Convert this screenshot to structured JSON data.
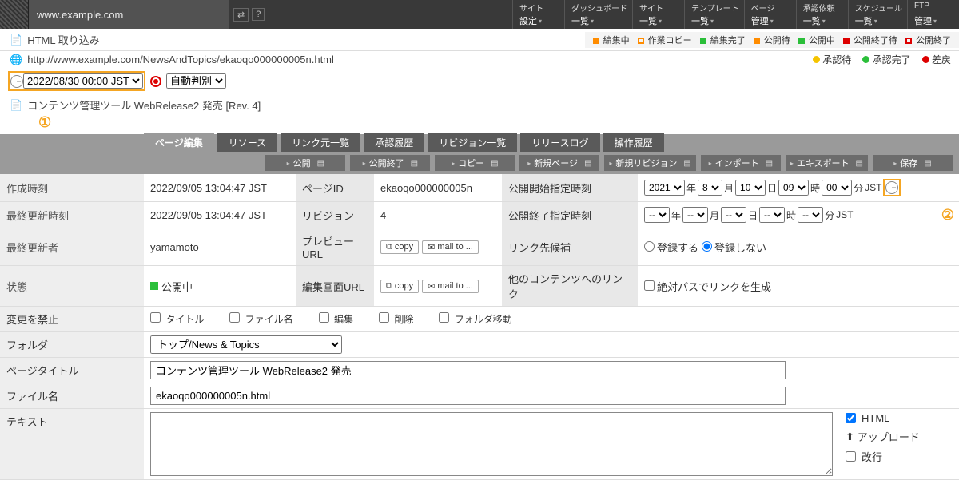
{
  "topbar": {
    "url_display": "www.example.com",
    "nav": [
      {
        "t1": "サイト",
        "t2": "設定"
      },
      {
        "t1": "ダッシュボード",
        "t2": "一覧"
      },
      {
        "t1": "サイト",
        "t2": "一覧"
      },
      {
        "t1": "テンプレート",
        "t2": "一覧"
      },
      {
        "t1": "ページ",
        "t2": "管理"
      },
      {
        "t1": "承認依頼",
        "t2": "一覧"
      },
      {
        "t1": "スケジュール",
        "t2": "一覧"
      },
      {
        "t1": "FTP",
        "t2": "管理"
      }
    ]
  },
  "status_strip": {
    "left_label": "HTML 取り込み",
    "items": [
      {
        "color": "#ff8c00",
        "shape": "sq",
        "label": "編集中"
      },
      {
        "color": "#ff8c00",
        "shape": "open",
        "label": "作業コピー"
      },
      {
        "color": "#2bbf3a",
        "shape": "sq",
        "label": "編集完了"
      },
      {
        "color": "#ff8c00",
        "shape": "sq",
        "label": "公開待"
      },
      {
        "color": "#2bbf3a",
        "shape": "sq",
        "label": "公開中"
      },
      {
        "color": "#d00",
        "shape": "sq",
        "label": "公開終了待"
      },
      {
        "color": "#d00",
        "shape": "open",
        "label": "公開終了"
      }
    ]
  },
  "path": "http://www.example.com/NewsAndTopics/ekaoqo000000005n.html",
  "approve_strip": [
    {
      "color": "#f5c400",
      "label": "承認待"
    },
    {
      "color": "#2bbf3a",
      "label": "承認完了"
    },
    {
      "color": "#d00",
      "label": "差戻"
    }
  ],
  "date_row": {
    "date_value": "2022/08/30 00:00 JST",
    "auto_value": "自動判別"
  },
  "desc_line": "コンテンツ管理ツール WebRelease2 発売 [Rev. 4]",
  "circle1": "①",
  "circle2": "②",
  "tabs": [
    "ページ編集",
    "リソース",
    "リンク元一覧",
    "承認履歴",
    "リビジョン一覧",
    "リリースログ",
    "操作履歴"
  ],
  "active_tab": 0,
  "actions": [
    "公開",
    "公開終了",
    "コピー",
    "新規ページ",
    "新規リビジョン",
    "インポート",
    "エキスポート",
    "保存"
  ],
  "grid": {
    "r1": {
      "l1": "作成時刻",
      "v1": "2022/09/05 13:04:47 JST",
      "l2": "ページID",
      "v2": "ekaoqo000000005n",
      "l3": "公開開始指定時刻"
    },
    "r1dates": {
      "year": "2021",
      "month": "8",
      "day": "10",
      "hour": "09",
      "min": "00",
      "tz": "JST"
    },
    "r2": {
      "l1": "最終更新時刻",
      "v1": "2022/09/05 13:04:47 JST",
      "l2": "リビジョン",
      "v2": "4",
      "l3": "公開終了指定時刻"
    },
    "r2dates": {
      "year": "--",
      "month": "--",
      "day": "--",
      "hour": "--",
      "min": "--",
      "tz": "JST"
    },
    "date_units": {
      "year": "年",
      "month": "月",
      "day": "日",
      "hour": "時",
      "min": "分"
    },
    "r3": {
      "l1": "最終更新者",
      "v1": "yamamoto",
      "l2": "プレビューURL",
      "copy": "copy",
      "mail": "mail to ...",
      "l3": "リンク先候補",
      "opt1": "登録する",
      "opt2": "登録しない"
    },
    "r4": {
      "l1": "状態",
      "v1": "公開中",
      "l2": "編集画面URL",
      "copy": "copy",
      "mail": "mail to ...",
      "l3": "他のコンテンツへのリンク",
      "opt": "絶対パスでリンクを生成"
    }
  },
  "change_prohibit": {
    "label": "変更を禁止",
    "opts": [
      "タイトル",
      "ファイル名",
      "編集",
      "削除",
      "フォルダ移動"
    ]
  },
  "folder": {
    "label": "フォルダ",
    "value": "トップ/News & Topics"
  },
  "page_title": {
    "label": "ページタイトル",
    "value": "コンテンツ管理ツール WebRelease2 発売"
  },
  "file_name": {
    "label": "ファイル名",
    "value": "ekaoqo000000005n.html"
  },
  "text": {
    "label": "テキスト",
    "html_label": "HTML",
    "upload": "アップロード",
    "wrap": "改行"
  }
}
